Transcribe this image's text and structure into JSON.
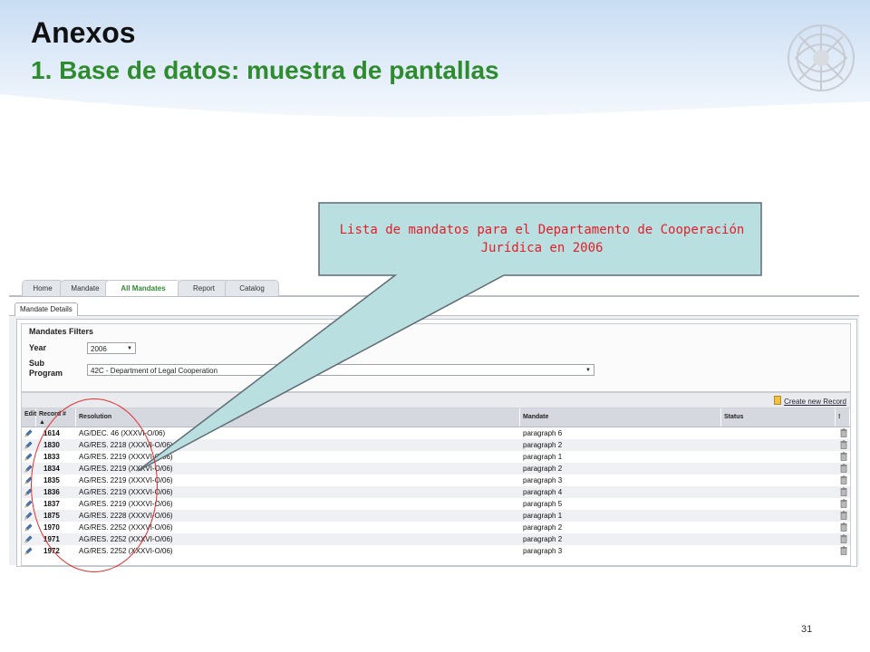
{
  "slide": {
    "title": "Anexos",
    "subtitle": "1. Base de datos: muestra de pantallas",
    "callout": "Lista de mandatos para el Departamento de Cooperación Jurídica en 2006",
    "page_number": "31"
  },
  "colors": {
    "title": "#111111",
    "subtitle": "#2e8b2e",
    "callout_fill": "#b9dfe1",
    "callout_border": "#5e6b73",
    "callout_text": "#e0202a",
    "header_wave": "#dbe9f7"
  },
  "app": {
    "nav_tabs": [
      "Home",
      "Mandate",
      "All Mandates",
      "Report",
      "Catalog"
    ],
    "active_nav_tab": "All Mandates",
    "sub_tab": "Mandate Details",
    "filters": {
      "legend": "Mandates Filters",
      "year_label": "Year",
      "year_value": "2006",
      "subprogram_label": "Sub Program",
      "subprogram_value": "42C - Department of Legal Cooperation"
    },
    "create_link": "Create new Record",
    "columns": {
      "edit": "Edit",
      "record": "Record #",
      "sort_glyph": "▲",
      "resolution": "Resolution",
      "mandate": "Mandate",
      "status": "Status",
      "delete": "!"
    },
    "rows": [
      {
        "record": "1614",
        "resolution": "AG/DEC. 46 (XXXVI-O/06)",
        "mandate": "paragraph 6",
        "status": ""
      },
      {
        "record": "1830",
        "resolution": "AG/RES. 2218 (XXXVI-O/06)",
        "mandate": "paragraph 2",
        "status": ""
      },
      {
        "record": "1833",
        "resolution": "AG/RES. 2219 (XXXVI-O/06)",
        "mandate": "paragraph 1",
        "status": ""
      },
      {
        "record": "1834",
        "resolution": "AG/RES. 2219 (XXXVI-O/06)",
        "mandate": "paragraph 2",
        "status": ""
      },
      {
        "record": "1835",
        "resolution": "AG/RES. 2219 (XXXVI-O/06)",
        "mandate": "paragraph 3",
        "status": ""
      },
      {
        "record": "1836",
        "resolution": "AG/RES. 2219 (XXXVI-O/06)",
        "mandate": "paragraph 4",
        "status": ""
      },
      {
        "record": "1837",
        "resolution": "AG/RES. 2219 (XXXVI-O/06)",
        "mandate": "paragraph 5",
        "status": ""
      },
      {
        "record": "1875",
        "resolution": "AG/RES. 2228 (XXXVI-O/06)",
        "mandate": "paragraph 1",
        "status": ""
      },
      {
        "record": "1970",
        "resolution": "AG/RES. 2252 (XXXVI-O/06)",
        "mandate": "paragraph 2",
        "status": ""
      },
      {
        "record": "1971",
        "resolution": "AG/RES. 2252 (XXXVI-O/06)",
        "mandate": "paragraph 2",
        "status": ""
      },
      {
        "record": "1972",
        "resolution": "AG/RES. 2252 (XXXVI-O/06)",
        "mandate": "paragraph 3",
        "status": ""
      }
    ]
  }
}
